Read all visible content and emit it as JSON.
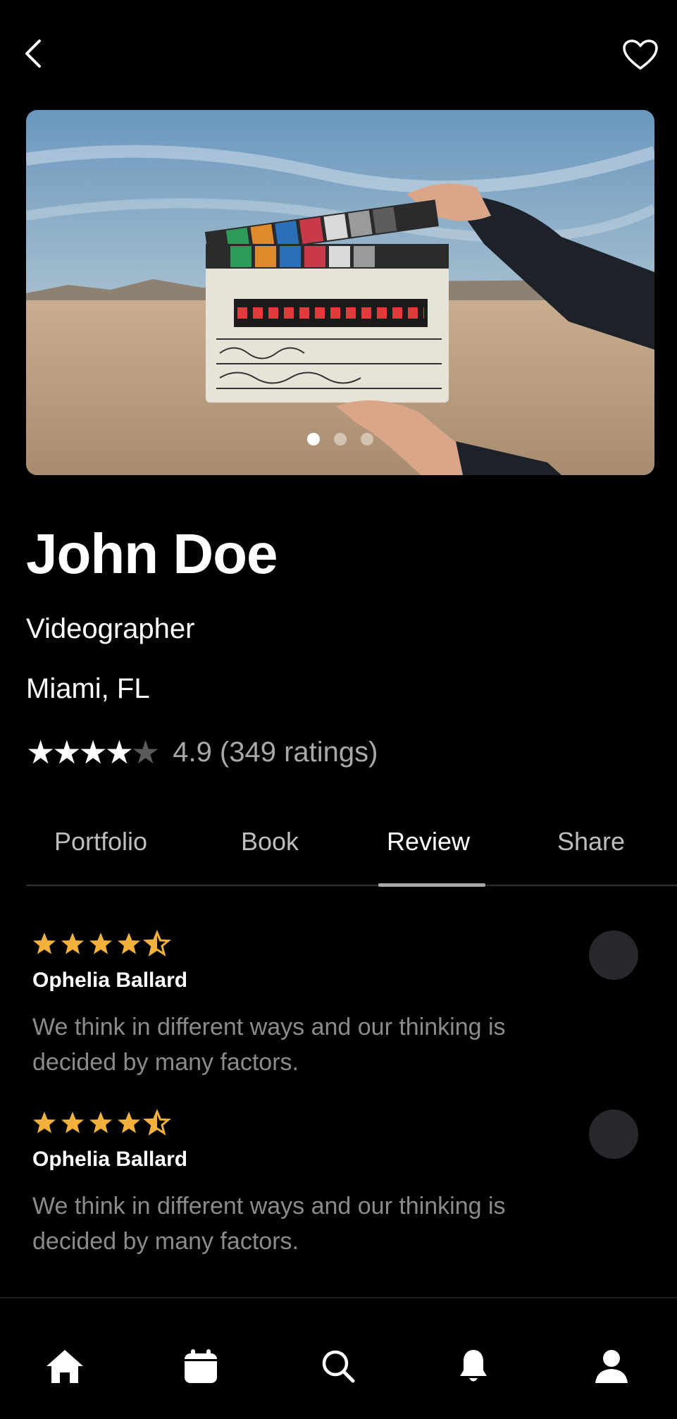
{
  "header": {
    "back_icon": "chevron-left-icon",
    "favorite_icon": "heart-outline-icon"
  },
  "hero": {
    "image": "film clapperboard held in desert",
    "slide_count": 3,
    "active_slide": 1
  },
  "profile": {
    "name": "John Doe",
    "role": "Videographer",
    "location": "Miami, FL",
    "rating_stars": 4,
    "rating_text": "4.9 (349 ratings)"
  },
  "tabs": [
    {
      "label": "Portfolio"
    },
    {
      "label": "Book"
    },
    {
      "label": "Review",
      "active": true
    },
    {
      "label": "Share"
    }
  ],
  "reviews": [
    {
      "stars": 4.5,
      "name": "Ophelia Ballard",
      "text": "We think in different ways and our thinking is decided by many factors."
    },
    {
      "stars": 4.5,
      "name": "Ophelia Ballard",
      "text": "We think in different ways and our thinking is decided by many factors."
    }
  ],
  "bottom_nav": [
    {
      "icon": "home-icon"
    },
    {
      "icon": "calendar-icon"
    },
    {
      "icon": "search-icon"
    },
    {
      "icon": "bell-icon"
    },
    {
      "icon": "user-icon"
    }
  ],
  "colors": {
    "background": "#000000",
    "star_accent": "#F2B13C",
    "muted_text": "#8B8B8B"
  }
}
